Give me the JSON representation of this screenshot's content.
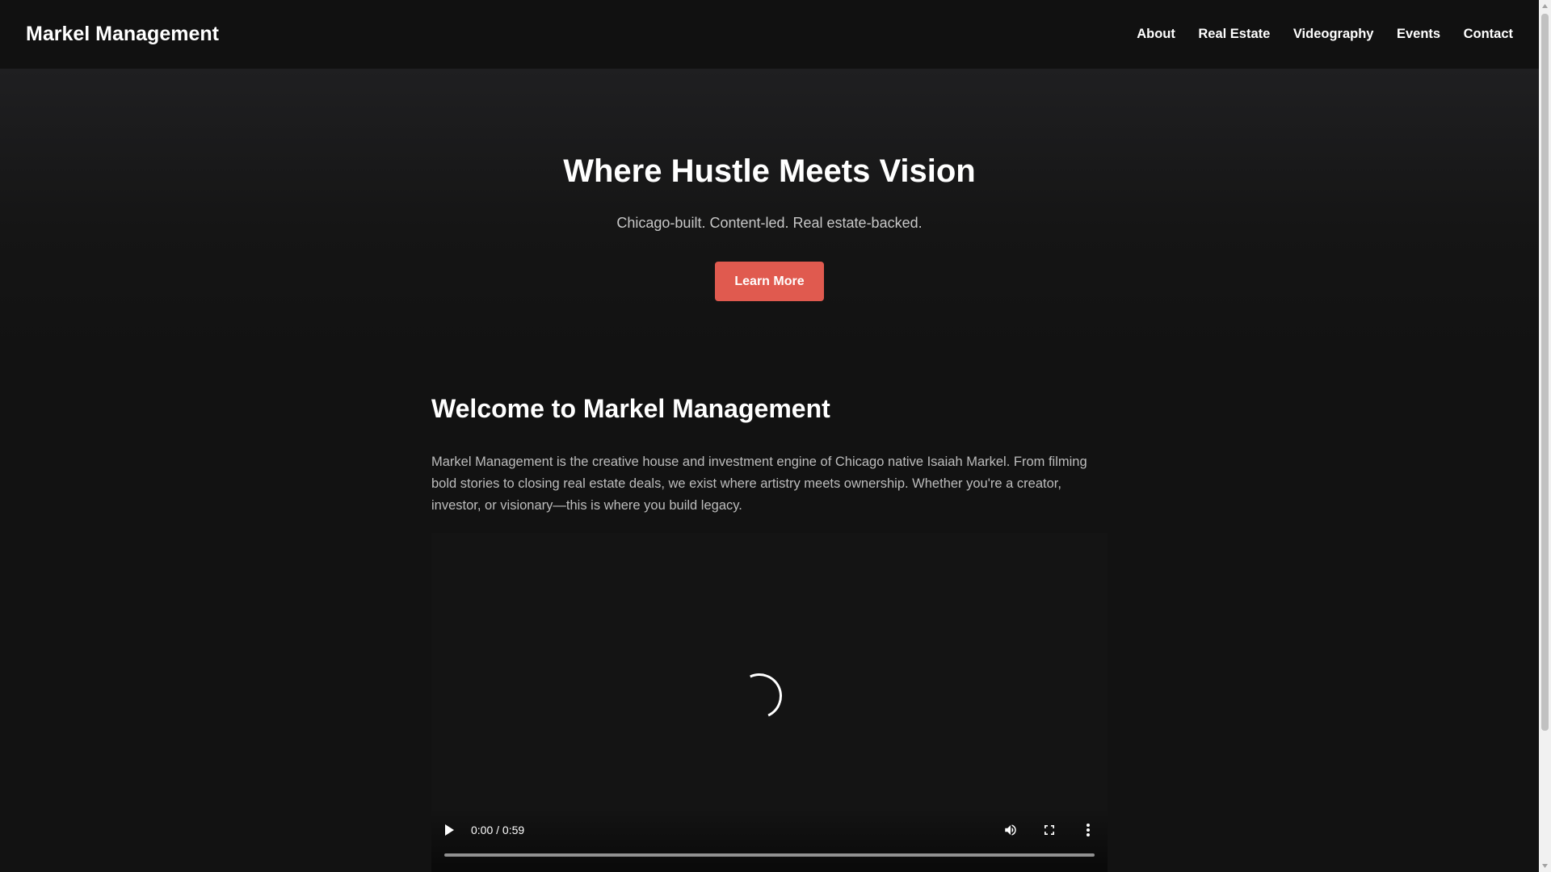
{
  "header": {
    "brand": "Markel Management",
    "nav": [
      "About",
      "Real Estate",
      "Videography",
      "Events",
      "Contact"
    ]
  },
  "hero": {
    "title": "Where Hustle Meets Vision",
    "subtitle": "Chicago-built. Content-led. Real estate-backed.",
    "cta_label": "Learn More"
  },
  "welcome": {
    "heading": "Welcome to Markel Management",
    "body": "Markel Management is the creative house and investment engine of Chicago native Isaiah Markel. From filming bold stories to closing real estate deals, we exist where artistry meets ownership. Whether you're a creator, investor, or visionary—this is where you build legacy."
  },
  "video": {
    "time_display": "0:00 / 0:59",
    "progress": 0,
    "icons": [
      "play-icon",
      "volume-icon",
      "fullscreen-icon",
      "more-options-icon"
    ],
    "state": "loading"
  },
  "colors": {
    "background": "#121212",
    "header": "#111111",
    "accent": "#e05a4f",
    "body_text": "#bdbdbd"
  }
}
